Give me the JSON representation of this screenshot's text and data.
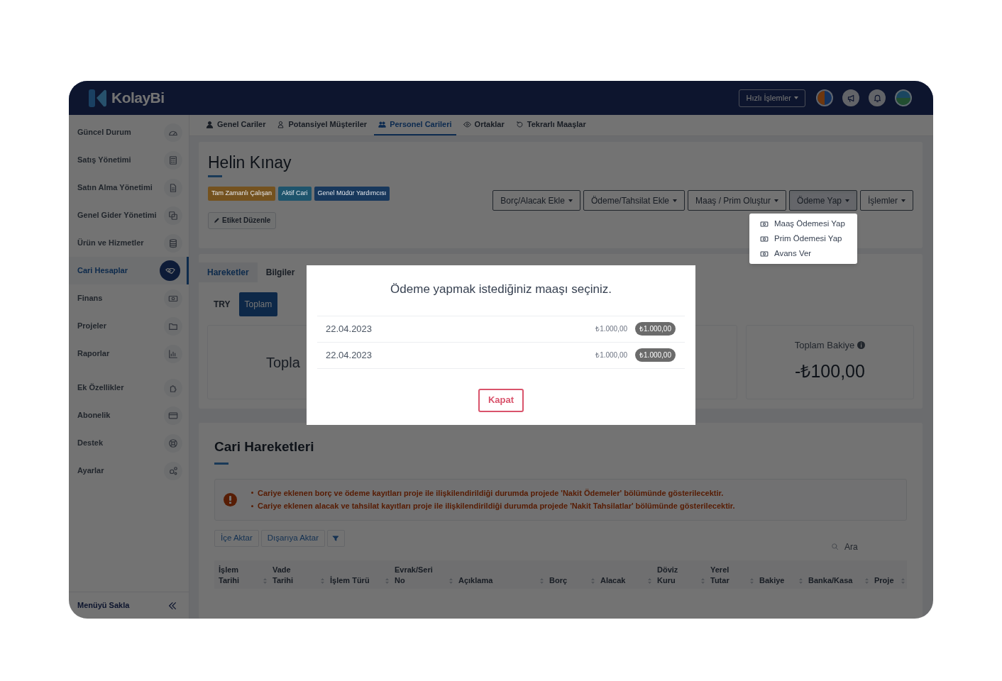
{
  "topbar": {
    "logo": "KolayBi",
    "quick_actions": "Hızlı İşlemler"
  },
  "sidebar": {
    "sections": [
      {
        "items": [
          {
            "label": "Güncel Durum",
            "selected": false
          },
          {
            "label": "Satış Yönetimi",
            "selected": false
          },
          {
            "label": "Satın Alma Yönetimi",
            "selected": false
          },
          {
            "label": "Genel Gider Yönetimi",
            "selected": false
          },
          {
            "label": "Ürün ve Hizmetler",
            "selected": false
          },
          {
            "label": "Cari Hesaplar",
            "selected": true
          },
          {
            "label": "Finans",
            "selected": false
          },
          {
            "label": "Projeler",
            "selected": false
          },
          {
            "label": "Raporlar",
            "selected": false
          }
        ]
      },
      {
        "items": [
          {
            "label": "Ek Özellikler",
            "selected": false
          },
          {
            "label": "Abonelik",
            "selected": false
          },
          {
            "label": "Destek",
            "selected": false
          },
          {
            "label": "Ayarlar",
            "selected": false
          }
        ]
      }
    ],
    "collapse": "Menüyü Sakla"
  },
  "top_tabs": [
    {
      "label": "Genel Cariler",
      "selected": false
    },
    {
      "label": "Potansiyel Müşteriler",
      "selected": false
    },
    {
      "label": "Personel Carileri",
      "selected": true
    },
    {
      "label": "Ortaklar",
      "selected": false
    },
    {
      "label": "Tekrarlı Maaşlar",
      "selected": false
    }
  ],
  "profile": {
    "name": "Helin Kınay",
    "tags": [
      {
        "label": "Tam Zamanlı Çalışan",
        "color": "#74521f"
      },
      {
        "label": "Aktif Cari",
        "color": "#1e546c"
      },
      {
        "label": "Genel Müdür Yardımcısı",
        "color": "#18385c"
      }
    ],
    "edit_tags": "Etiket Düzenle",
    "actions": [
      {
        "label": "Borç/Alacak Ekle",
        "expanded": false
      },
      {
        "label": "Ödeme/Tahsilat Ekle",
        "expanded": false
      },
      {
        "label": "Maaş / Prim Oluştur",
        "expanded": false
      },
      {
        "label": "Ödeme Yap",
        "expanded": true
      },
      {
        "label": "İşlemler",
        "expanded": false
      }
    ],
    "menu": [
      "Maaş Ödemesi Yap",
      "Prim Ödemesi Yap",
      "Avans Ver"
    ]
  },
  "detail_tabs": [
    {
      "label": "Hareketler",
      "selected": true
    },
    {
      "label": "Bilgiler",
      "selected": false
    }
  ],
  "currency_tabs": [
    {
      "label": "TRY",
      "selected": false
    },
    {
      "label": "Toplam",
      "selected": true
    }
  ],
  "summary": {
    "total_label": "Topla",
    "balance_label": "Toplam Bakiye",
    "balance": "-₺100,00"
  },
  "movements": {
    "title": "Cari Hareketleri",
    "notices": [
      "Cariye eklenen borç ve ödeme kayıtları proje ile ilişkilendirildiği durumda projede 'Nakit Ödemeler' bölümünde gösterilecektir.",
      "Cariye eklenen alacak ve tahsilat kayıtları proje ile ilişkilendirildiği durumda projede 'Nakit Tahsilatlar' bölümünde gösterilecektir."
    ],
    "toolbar": [
      "İçe Aktar",
      "Dışarıya Aktar"
    ],
    "search_placeholder": "Ara",
    "columns": [
      "İşlem Tarihi",
      "Vade Tarihi",
      "İşlem Türü",
      "Evrak/Seri No",
      "Açıklama",
      "Borç",
      "Alacak",
      "Döviz Kuru",
      "Yerel Tutar",
      "Bakiye",
      "Banka/Kasa",
      "Proje"
    ]
  },
  "modal": {
    "title": "Ödeme yapmak istediğiniz maaşı seçiniz.",
    "rows": [
      {
        "date": "22.04.2023",
        "amount": "₺1.000,00",
        "badge": "₺1.000,00"
      },
      {
        "date": "22.04.2023",
        "amount": "₺1.000,00",
        "badge": "₺1.000,00"
      }
    ],
    "close": "Kapat"
  }
}
